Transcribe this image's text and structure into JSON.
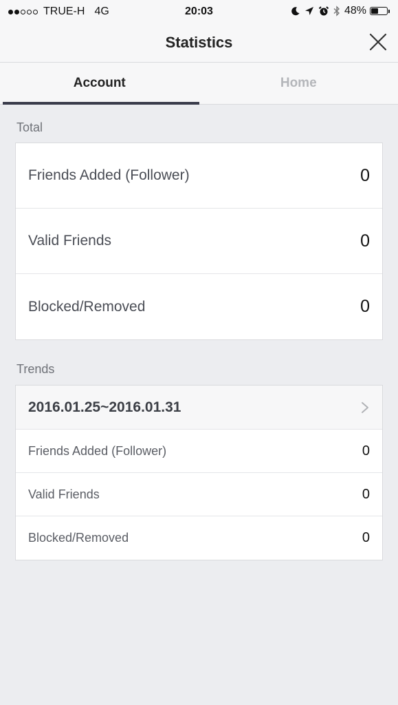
{
  "status_bar": {
    "carrier": "TRUE-H",
    "network": "4G",
    "time": "20:03",
    "battery_percent_text": "48%",
    "battery_level": 0.48,
    "signal_bars_filled": 2,
    "signal_bars_total": 5
  },
  "header": {
    "title": "Statistics"
  },
  "tabs": [
    {
      "label": "Account",
      "active": true
    },
    {
      "label": "Home",
      "active": false
    }
  ],
  "total": {
    "label": "Total",
    "rows": [
      {
        "label": "Friends Added (Follower)",
        "value": "0"
      },
      {
        "label": "Valid Friends",
        "value": "0"
      },
      {
        "label": "Blocked/Removed",
        "value": "0"
      }
    ]
  },
  "trends": {
    "label": "Trends",
    "date_range": "2016.01.25~2016.01.31",
    "rows": [
      {
        "label": "Friends Added (Follower)",
        "value": "0"
      },
      {
        "label": "Valid Friends",
        "value": "0"
      },
      {
        "label": "Blocked/Removed",
        "value": "0"
      }
    ]
  },
  "colors": {
    "background": "#ecedf0",
    "tab_indicator": "#3a3c4b",
    "card": "#ffffff"
  }
}
